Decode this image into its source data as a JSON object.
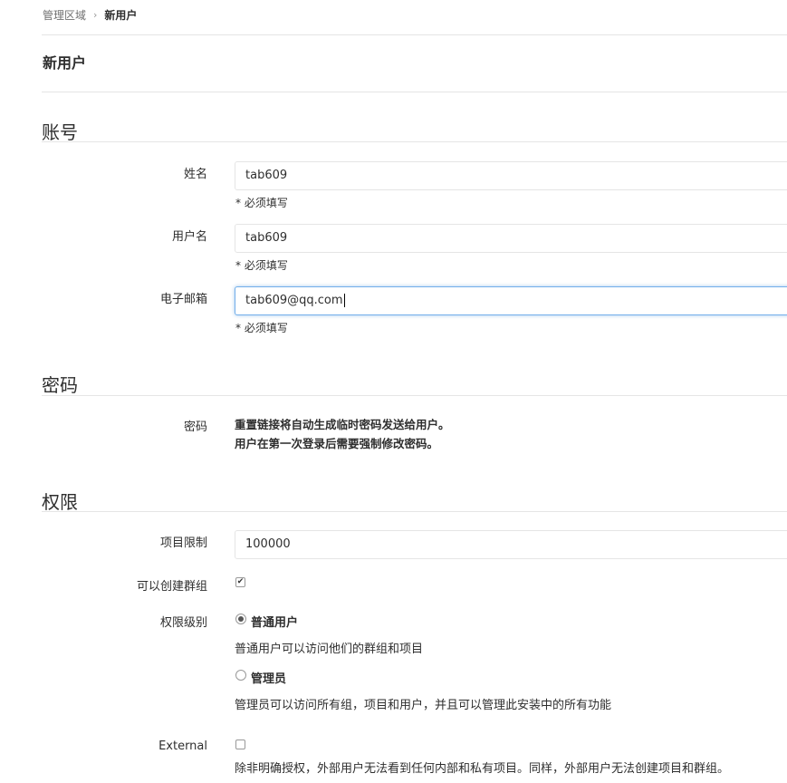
{
  "breadcrumb": {
    "parent": "管理区域",
    "separator": "›",
    "current": "新用户"
  },
  "page_title": "新用户",
  "account": {
    "title": "账号",
    "name": {
      "label": "姓名",
      "value": "tab609",
      "help": "* 必须填写"
    },
    "username": {
      "label": "用户名",
      "value": "tab609",
      "help": "* 必须填写"
    },
    "email": {
      "label": "电子邮箱",
      "value": "tab609@qq.com",
      "help": "* 必须填写"
    }
  },
  "password": {
    "title": "密码",
    "label": "密码",
    "line1": "重置链接将自动生成临时密码发送给用户。",
    "line2": "用户在第一次登录后需要强制修改密码。"
  },
  "permissions": {
    "title": "权限",
    "projects_limit": {
      "label": "项目限制",
      "value": "100000"
    },
    "can_create_group": {
      "label": "可以创建群组",
      "checked": true,
      "check_glyph": "✔"
    },
    "access_level": {
      "label": "权限级别",
      "regular": {
        "label": "普通用户",
        "desc": "普通用户可以访问他们的群组和项目",
        "selected": true
      },
      "admin": {
        "label": "管理员",
        "desc": "管理员可以访问所有组，项目和用户，并且可以管理此安装中的所有功能",
        "selected": false
      }
    },
    "external": {
      "label": "External",
      "checked": false,
      "desc": "除非明确授权，外部用户无法看到任何内部和私有项目。同样，外部用户无法创建项目和群组。"
    }
  },
  "colors": {
    "focus_border": "#73afea",
    "border": "#e5e5e5",
    "text": "#2e2e2e"
  }
}
